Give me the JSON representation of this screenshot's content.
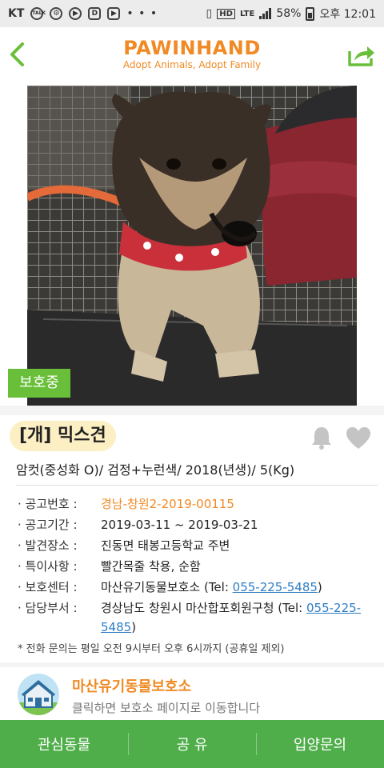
{
  "statusbar": {
    "carrier": "KT",
    "talk_icon": "TALK",
    "dots": "• • •",
    "battery": "58%",
    "time": "오후 12:01",
    "lte": "LTE"
  },
  "header": {
    "logo_title": "PAWINHAND",
    "logo_subtitle": "Adopt Animals, Adopt Family",
    "back_icon": "chevron-left-icon",
    "share_icon": "share-icon"
  },
  "photo": {
    "status_tag": "보호중"
  },
  "animal": {
    "title": "[개] 믹스견",
    "summary": "암컷(중성화 O)/ 검정+누런색/ 2018(년생)/ 5(Kg)"
  },
  "details": [
    {
      "label": "· 공고번호 :",
      "value": "경남-창원2-2019-00115"
    },
    {
      "label": "· 공고기간 :",
      "value": "2019-03-11 ~ 2019-03-21"
    },
    {
      "label": "· 발견장소 :",
      "value": "진동면 태봉고등학교 주변"
    },
    {
      "label": "· 특이사항 :",
      "value": "빨간목줄 착용, 순함"
    },
    {
      "label": "· 보호센터 :",
      "value": "마산유기동물보호소 (Tel: ",
      "tel": "055-225-5485",
      "tail": ")"
    },
    {
      "label": "· 담당부서 :",
      "value": "경상남도 창원시 마산합포회원구청 (Tel: ",
      "tel": "055-225-5485",
      "tail": ")"
    }
  ],
  "note": "* 전화 문의는 평일 오전 9시부터 오후 6시까지 (공휴일 제외)",
  "center": {
    "name": "마산유기동물보호소",
    "desc": "클릭하면 보호소 페이지로 이동합니다"
  },
  "bottom_bar": {
    "favorites": "관심동물",
    "share": "공 유",
    "adopt": "입양문의"
  },
  "colors": {
    "brand_orange": "#f08a24",
    "brand_green": "#4fae4a",
    "tag_green": "#6abf3a",
    "link_blue": "#2e7dc4"
  }
}
